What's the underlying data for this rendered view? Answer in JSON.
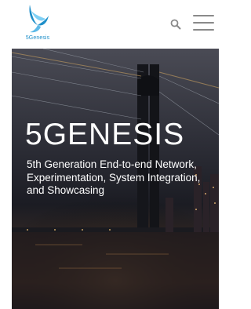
{
  "header": {
    "logo_text": "5Genesis",
    "search_icon": "search-icon",
    "menu_icon": "hamburger-menu-icon"
  },
  "hero": {
    "title": "5GENESIS",
    "subtitle": "5th Generation End-to-end Network, Experimentation, System Integration, and Showcasing"
  },
  "colors": {
    "logo_primary": "#1e8fc9",
    "logo_light": "#7fd0f5",
    "icon_gray": "#8a8a8a",
    "hero_text": "#ffffff"
  }
}
